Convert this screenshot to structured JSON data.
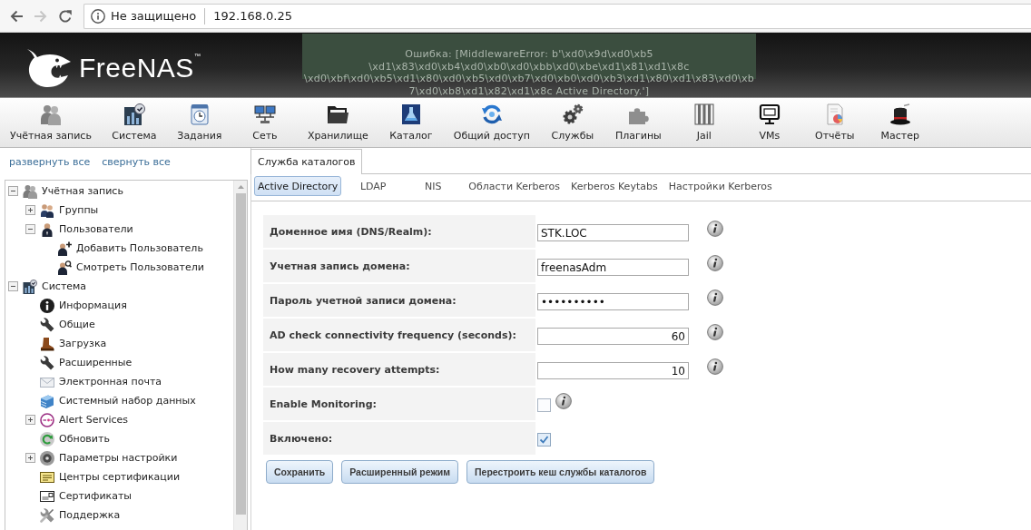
{
  "browser": {
    "nav": [
      {
        "kind": "back",
        "disabled": false
      },
      {
        "kind": "forward",
        "disabled": true
      },
      {
        "kind": "reload",
        "disabled": false
      }
    ],
    "security_label": "Не защищено",
    "url": "192.168.0.25"
  },
  "header": {
    "logo": "FreeNAS$^{™}$",
    "error": "Ошибка: [MiddlewareError: b'\\xd0\\x9d\\xd0\\xb5 \\xd1\\x83\\xd0\\xb4\\xd0\\xb0\\xd0\\xbb\\xd0\\xbe\\xd1\\x81\\xd1\\x8c \\xd0\\xbf\\xd0\\xb5\\xd1\\x80\\xd0\\xb5\\xd0\\xb7\\xd0\\xb0\\xd0\\xb3\\xd1\\x80\\xd1\\x83\\xd0\\xb7\\xd0\\xb8\\xd1\\x82\\xd1\\x8c Active Directory.']"
  },
  "toolbar": [
    {
      "label": "Учётная запись"
    },
    {
      "label": "Система"
    },
    {
      "label": "Задания"
    },
    {
      "label": "Сеть"
    },
    {
      "label": "Хранилище"
    },
    {
      "label": "Каталог"
    },
    {
      "label": "Общий доступ"
    },
    {
      "label": "Службы"
    },
    {
      "label": "Плагины"
    },
    {
      "label": "Jail"
    },
    {
      "label": "VMs"
    },
    {
      "label": "Отчёты"
    },
    {
      "label": "Мастер"
    }
  ],
  "sidebar": {
    "links": [
      "развернуть все",
      "свернуть все"
    ],
    "tree": [
      {
        "label": "Учётная запись",
        "expanded": true,
        "children": [
          {
            "label": "Группы",
            "expanded": false
          },
          {
            "label": "Пользователи",
            "expanded": true,
            "children": [
              {
                "label": "Добавить Пользователь"
              },
              {
                "label": "Смотреть Пользователи"
              }
            ]
          }
        ]
      },
      {
        "label": "Система",
        "expanded": true,
        "children": [
          {
            "label": "Информация"
          },
          {
            "label": "Общие"
          },
          {
            "label": "Загрузка"
          },
          {
            "label": "Расширенные"
          },
          {
            "label": "Электронная почта"
          },
          {
            "label": "Системный набор данных"
          },
          {
            "label": "Alert Services",
            "expanded": false
          },
          {
            "label": "Обновить"
          },
          {
            "label": "Параметры настройки",
            "expanded": false
          },
          {
            "label": "Центры сертификации"
          },
          {
            "label": "Сертификаты"
          },
          {
            "label": "Поддержка"
          }
        ]
      }
    ]
  },
  "tabs": [
    {
      "label": "Служба каталогов",
      "selected": true
    }
  ],
  "subtabs": [
    {
      "label": "Active Directory",
      "selected": true
    },
    {
      "label": "LDAP",
      "selected": false
    },
    {
      "label": "NIS",
      "selected": false
    },
    {
      "label": "Области Kerberos",
      "selected": false
    },
    {
      "label": "Kerberos Keytabs",
      "selected": false
    },
    {
      "label": "Настройки Kerberos",
      "selected": false
    }
  ],
  "form": {
    "fields": [
      {
        "kind": "text",
        "label": "Доменное имя (DNS/Realm):",
        "value": "STK.LOC",
        "info": true
      },
      {
        "kind": "text",
        "label": "Учетная запись домена:",
        "value": "freenasAdm",
        "info": true
      },
      {
        "kind": "password",
        "label": "Пароль учетной записи домена:",
        "value": "••••••••••",
        "info": true
      },
      {
        "kind": "number",
        "label": "AD check connectivity frequency (seconds):",
        "value": "60",
        "info": true
      },
      {
        "kind": "number",
        "label": "How many recovery attempts:",
        "value": "10",
        "info": true
      },
      {
        "kind": "checkbox",
        "label": "Enable Monitoring:",
        "checked": false,
        "info": true
      },
      {
        "kind": "checkbox",
        "label": "Включено:",
        "checked": true,
        "info": false
      }
    ],
    "buttons": [
      "Сохранить",
      "Расширенный режим",
      "Перестроить кеш службы каталогов"
    ]
  }
}
